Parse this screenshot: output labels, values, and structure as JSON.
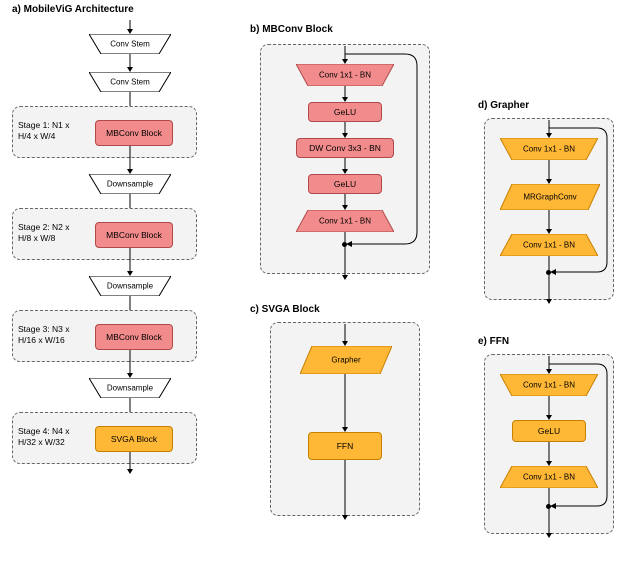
{
  "titles": {
    "a": "a) MobileViG Architecture",
    "b": "b) MBConv Block",
    "c": "c) SVGA Block",
    "d": "d) Grapher",
    "e": "e) FFN"
  },
  "colA": {
    "conv_stem1": "Conv Stem",
    "conv_stem2": "Conv Stem",
    "stage1_label": "Stage 1: N1 x\nH/4 x W/4",
    "stage1_block": "MBConv Block",
    "down1": "Downsample",
    "stage2_label": "Stage 2: N2 x\nH/8 x W/8",
    "stage2_block": "MBConv Block",
    "down2": "Downsample",
    "stage3_label": "Stage 3: N3 x\nH/16 x W/16",
    "stage3_block": "MBConv Block",
    "down3": "Downsample",
    "stage4_label": "Stage 4: N4 x\nH/32 x W/32",
    "stage4_block": "SVGA Block"
  },
  "mbconv": {
    "c1": "Conv 1x1 - BN",
    "g1": "GeLU",
    "dw": "DW Conv 3x3 - BN",
    "g2": "GeLU",
    "c2": "Conv 1x1 - BN"
  },
  "svga": {
    "g": "Grapher",
    "f": "FFN"
  },
  "grapher": {
    "c1": "Conv 1x1 - BN",
    "mr": "MRGraphConv",
    "c2": "Conv 1x1 - BN"
  },
  "ffn": {
    "c1": "Conv 1x1 - BN",
    "g": "GeLU",
    "c2": "Conv 1x1 - BN"
  }
}
